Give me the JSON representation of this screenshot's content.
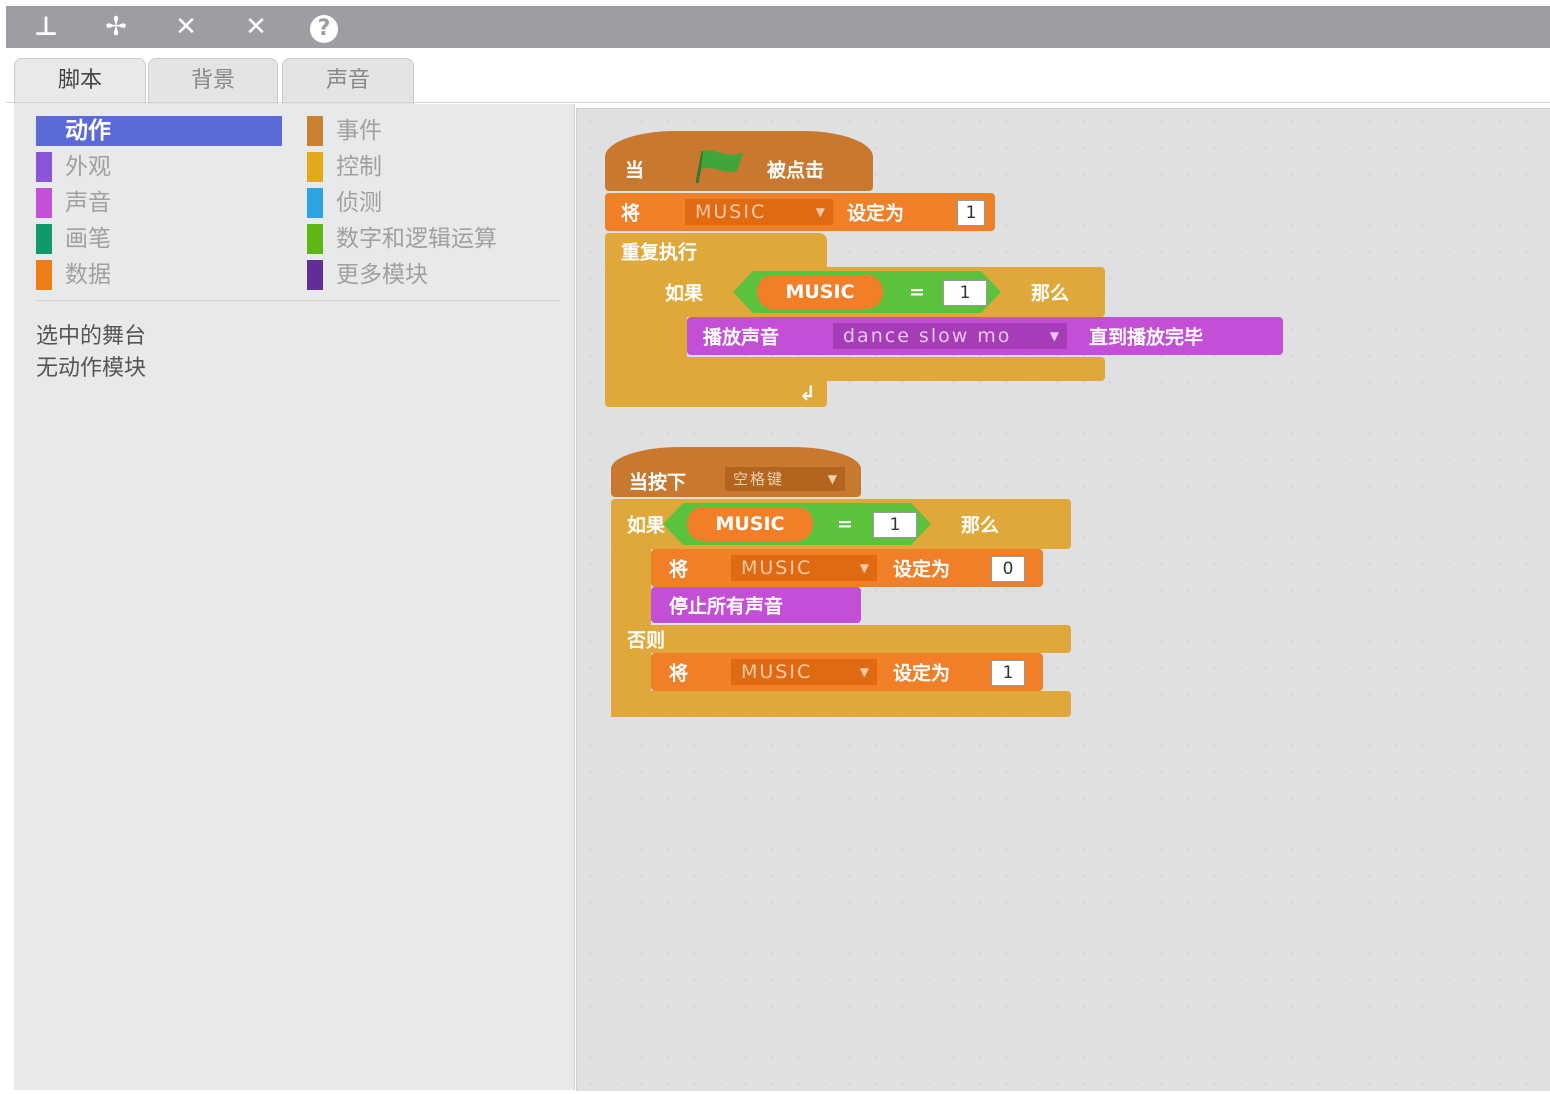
{
  "toolbar": {
    "icons": [
      "stamp-icon",
      "cut-icon",
      "grow-icon",
      "shrink-icon",
      "help-icon"
    ],
    "glyphs": {
      "stamp": "⊥",
      "cut": "✢",
      "grow": "✕",
      "shrink": "✕",
      "help": "?"
    }
  },
  "tabs": [
    "脚本",
    "背景",
    "声音"
  ],
  "categories_left": [
    {
      "label": "动作",
      "color": "#5c6ad8"
    },
    {
      "label": "外观",
      "color": "#8a55d7"
    },
    {
      "label": "声音",
      "color": "#c34fd6"
    },
    {
      "label": "画笔",
      "color": "#0e9a6c"
    },
    {
      "label": "数据",
      "color": "#ee7d16"
    }
  ],
  "categories_right": [
    {
      "label": "事件",
      "color": "#c88330"
    },
    {
      "label": "控制",
      "color": "#e1a91a"
    },
    {
      "label": "侦测",
      "color": "#2ca5e2"
    },
    {
      "label": "数字和逻辑运算",
      "color": "#5cb712"
    },
    {
      "label": "更多模块",
      "color": "#632d99"
    }
  ],
  "palette_message": [
    "选中的舞台",
    "无动作模块"
  ],
  "script1": {
    "hat_when": "当",
    "hat_clicked": "被点击",
    "set_word": "将",
    "var_name": "MUSIC",
    "set_to": "设定为",
    "set_value": "1",
    "forever": "重复执行",
    "if_word": "如果",
    "var_reporter": "MUSIC",
    "equals": "=",
    "compare_value": "1",
    "then_word": "那么",
    "play_sound": "播放声音",
    "sound_name": "dance slow mo",
    "until_done": "直到播放完毕",
    "loop_arrow": "↲"
  },
  "script2": {
    "hat_key": "当按下",
    "key_name": "空格键",
    "if_word": "如果",
    "var_reporter": "MUSIC",
    "equals": "=",
    "compare_value": "1",
    "then_word": "那么",
    "set_word": "将",
    "var_name": "MUSIC",
    "set_to": "设定为",
    "set_value_a": "0",
    "stop_sounds": "停止所有声音",
    "else_word": "否则",
    "set_value_b": "1"
  },
  "colors": {
    "events": "#c8792f",
    "control": "#e0a73a",
    "data": "#f07f28",
    "sound": "#c34fd6",
    "operators": "#5ac23c",
    "flag": "#3fa63a"
  }
}
